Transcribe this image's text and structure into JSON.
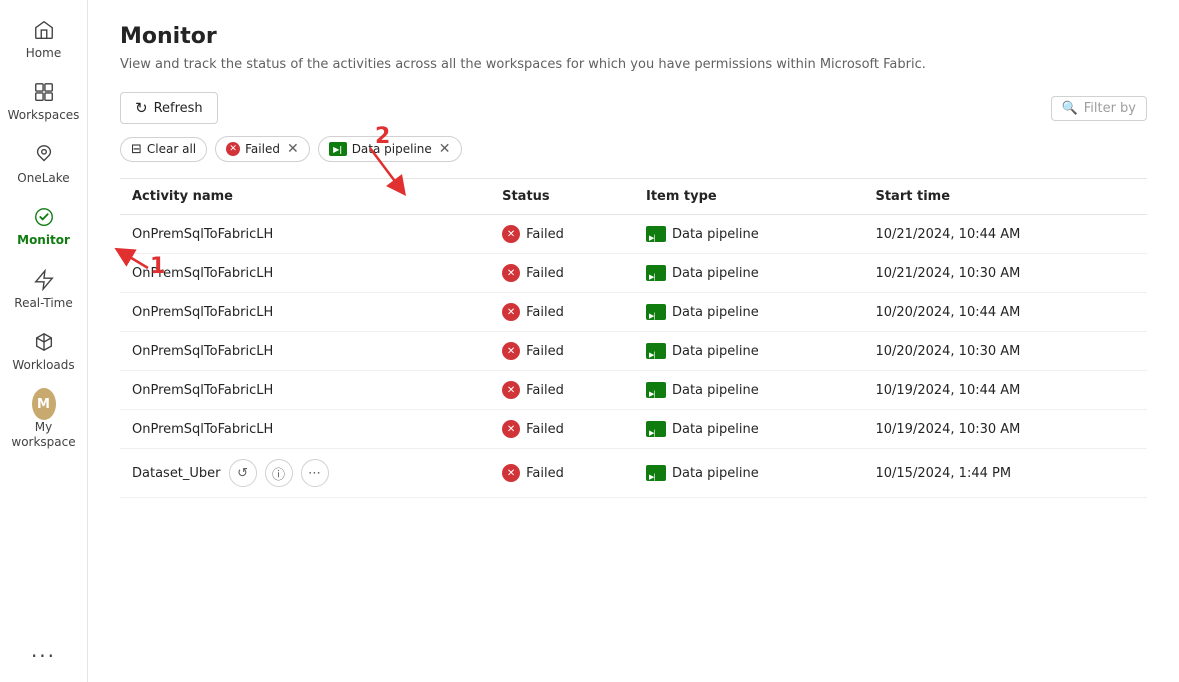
{
  "sidebar": {
    "items": [
      {
        "id": "home",
        "label": "Home",
        "icon": "home"
      },
      {
        "id": "workspaces",
        "label": "Workspaces",
        "icon": "workspaces"
      },
      {
        "id": "onelake",
        "label": "OneLake",
        "icon": "onelake"
      },
      {
        "id": "monitor",
        "label": "Monitor",
        "icon": "monitor",
        "active": true
      },
      {
        "id": "realtime",
        "label": "Real-Time",
        "icon": "realtime"
      },
      {
        "id": "workloads",
        "label": "Workloads",
        "icon": "workloads"
      },
      {
        "id": "myworkspace",
        "label": "My workspace",
        "icon": "avatar"
      }
    ],
    "more_label": "..."
  },
  "header": {
    "title": "Monitor",
    "subtitle": "View and track the status of the activities across all the workspaces for which you have permissions within Microsoft Fabric."
  },
  "toolbar": {
    "refresh_label": "Refresh",
    "filter_placeholder": "Filter by"
  },
  "filter_tags": {
    "clear_label": "Clear all",
    "tags": [
      {
        "id": "failed",
        "label": "Failed",
        "type": "status"
      },
      {
        "id": "datapipeline",
        "label": "Data pipeline",
        "type": "itemtype"
      }
    ]
  },
  "table": {
    "columns": [
      "Activity name",
      "Status",
      "Item type",
      "Start time"
    ],
    "rows": [
      {
        "activity": "OnPremSqlToFabricLH",
        "status": "Failed",
        "item_type": "Data pipeline",
        "start_time": "10/21/2024, 10:44 AM",
        "has_actions": false
      },
      {
        "activity": "OnPremSqlToFabricLH",
        "status": "Failed",
        "item_type": "Data pipeline",
        "start_time": "10/21/2024, 10:30 AM",
        "has_actions": false
      },
      {
        "activity": "OnPremSqlToFabricLH",
        "status": "Failed",
        "item_type": "Data pipeline",
        "start_time": "10/20/2024, 10:44 AM",
        "has_actions": false
      },
      {
        "activity": "OnPremSqlToFabricLH",
        "status": "Failed",
        "item_type": "Data pipeline",
        "start_time": "10/20/2024, 10:30 AM",
        "has_actions": false
      },
      {
        "activity": "OnPremSqlToFabricLH",
        "status": "Failed",
        "item_type": "Data pipeline",
        "start_time": "10/19/2024, 10:44 AM",
        "has_actions": false
      },
      {
        "activity": "OnPremSqlToFabricLH",
        "status": "Failed",
        "item_type": "Data pipeline",
        "start_time": "10/19/2024, 10:30 AM",
        "has_actions": false
      },
      {
        "activity": "Dataset_Uber",
        "status": "Failed",
        "item_type": "Data pipeline",
        "start_time": "10/15/2024, 1:44 PM",
        "has_actions": true
      }
    ]
  },
  "annotations": {
    "label1": "1",
    "label2": "2"
  }
}
